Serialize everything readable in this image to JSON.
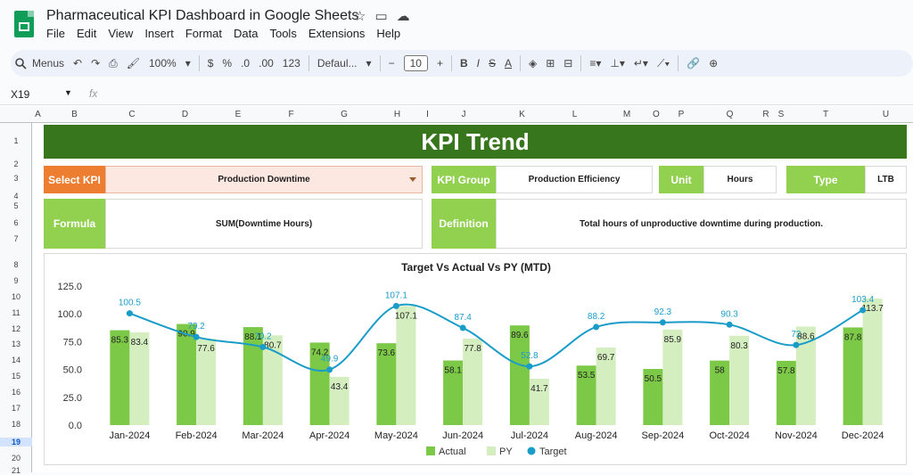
{
  "app": {
    "doc_title": "Pharmaceutical KPI Dashboard in Google Sheets",
    "menu": [
      "File",
      "Edit",
      "View",
      "Insert",
      "Format",
      "Data",
      "Tools",
      "Extensions",
      "Help"
    ]
  },
  "toolbar": {
    "search_label": "Menus",
    "zoom": "100%",
    "currency": "$",
    "percent": "%",
    "dec_decrease": ".0",
    "dec_increase": ".00",
    "num_format": "123",
    "font": "Defaul...",
    "font_size": "10",
    "bold": "B",
    "italic": "I",
    "strike": "S",
    "text_color": "A"
  },
  "formula_bar": {
    "cell_ref": "X19",
    "fx": "fx"
  },
  "columns": [
    "A",
    "B",
    "C",
    "D",
    "E",
    "F",
    "G",
    "H",
    "I",
    "J",
    "K",
    "L",
    "M",
    "O",
    "P",
    "Q",
    "R",
    "S",
    "T",
    "U"
  ],
  "rows": [
    "1",
    "2",
    "3",
    "4",
    "5",
    "6",
    "7",
    "8",
    "9",
    "10",
    "11",
    "12",
    "13",
    "14",
    "15",
    "16",
    "17",
    "18",
    "19",
    "20",
    "21"
  ],
  "active_row": "19",
  "dashboard": {
    "banner": "KPI Trend",
    "select_kpi_label": "Select KPI",
    "select_kpi_value": "Production Downtime",
    "kpi_group_label": "KPI Group",
    "kpi_group_value": "Production Efficiency",
    "unit_label": "Unit",
    "unit_value": "Hours",
    "type_label": "Type",
    "type_value": "LTB",
    "formula_label": "Formula",
    "formula_value": "SUM(Downtime Hours)",
    "definition_label": "Definition",
    "definition_value": "Total hours of unproductive downtime during production."
  },
  "colors": {
    "banner": "#38761d",
    "label_green": "#92d050",
    "label_orange": "#ed7d31",
    "actual": "#7cc847",
    "py": "#d5eec0",
    "target": "#1a9cc9"
  },
  "chart_data": {
    "type": "bar",
    "title": "Target Vs Actual Vs PY (MTD)",
    "categories": [
      "Jan-2024",
      "Feb-2024",
      "Mar-2024",
      "Apr-2024",
      "May-2024",
      "Jun-2024",
      "Jul-2024",
      "Aug-2024",
      "Sep-2024",
      "Oct-2024",
      "Nov-2024",
      "Dec-2024"
    ],
    "series": [
      {
        "name": "Actual",
        "type": "bar",
        "values": [
          85.3,
          90.9,
          88.1,
          74.2,
          73.6,
          58.1,
          89.6,
          53.5,
          50.5,
          58.0,
          57.8,
          87.8
        ]
      },
      {
        "name": "PY",
        "type": "bar",
        "values": [
          83.4,
          77.6,
          80.7,
          43.4,
          107.1,
          77.8,
          41.7,
          69.7,
          85.9,
          80.3,
          88.6,
          113.7
        ]
      },
      {
        "name": "Target",
        "type": "line",
        "values": [
          100.5,
          79.2,
          70.2,
          49.9,
          107.1,
          87.4,
          52.8,
          88.2,
          92.3,
          90.3,
          72.0,
          103.4
        ]
      }
    ],
    "yticks": [
      "0.0",
      "25.0",
      "50.0",
      "75.0",
      "100.0",
      "125.0"
    ],
    "ylim": [
      0,
      125
    ],
    "legend": "bottom"
  }
}
